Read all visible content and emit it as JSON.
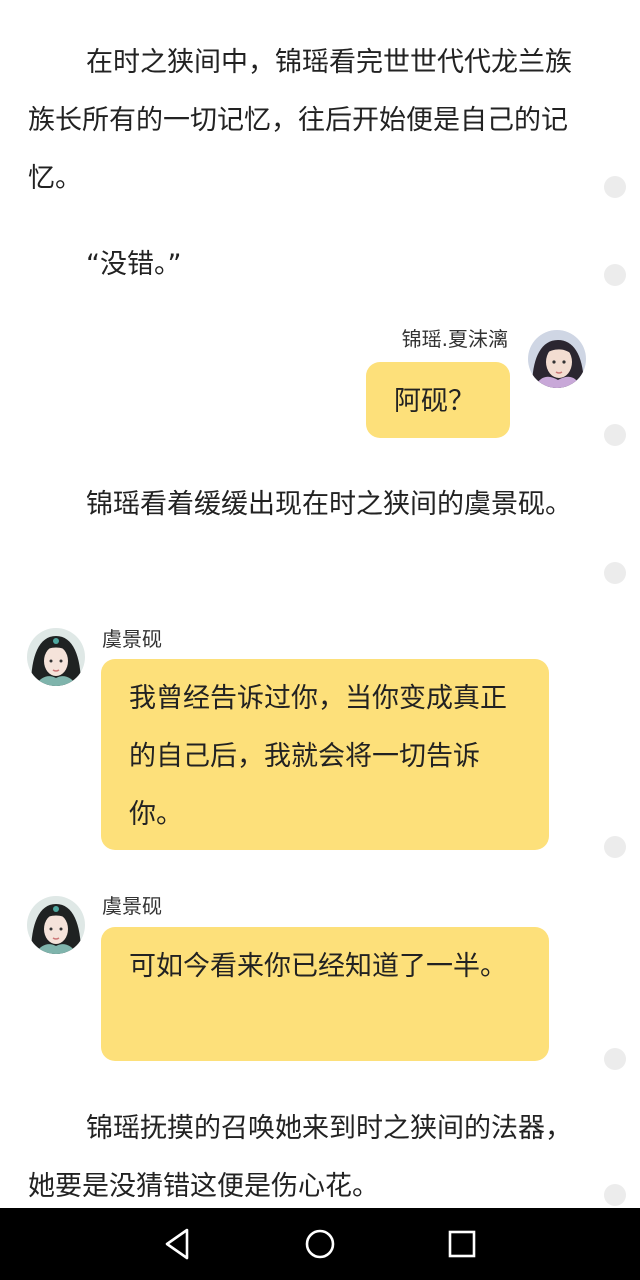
{
  "content": {
    "p1": "在时之狭间中，锦瑶看完世世代代龙兰族族长所有的一切记忆，往后开始便是自己的记忆。",
    "p2": "“没错。”",
    "p3": "锦瑶看着缓缓出现在时之狭间的虞景砚。",
    "p4": "锦瑶抚摸的召唤她来到时之狭间的法器，她要是没猜错这便是伤心花。"
  },
  "chat": {
    "m1": {
      "speaker": "锦瑶.夏沫漓",
      "text": "阿砚？",
      "avatar": "avatar-girl-1"
    },
    "m2": {
      "speaker": "虞景砚",
      "text": "我曾经告诉过你，当你变成真正的自己后，我就会将一切告诉你。",
      "avatar": "avatar-girl-2"
    },
    "m3": {
      "speaker": "虞景砚",
      "text": "可如今看来你已经知道了一半。",
      "avatar": "avatar-girl-2"
    }
  },
  "navbar": {
    "back_icon": "back-triangle-icon",
    "home_icon": "home-circle-icon",
    "recents_icon": "recents-square-icon"
  },
  "colors": {
    "bubble": "#fde07a",
    "navbar": "#000000",
    "side_dot": "#ececec"
  }
}
